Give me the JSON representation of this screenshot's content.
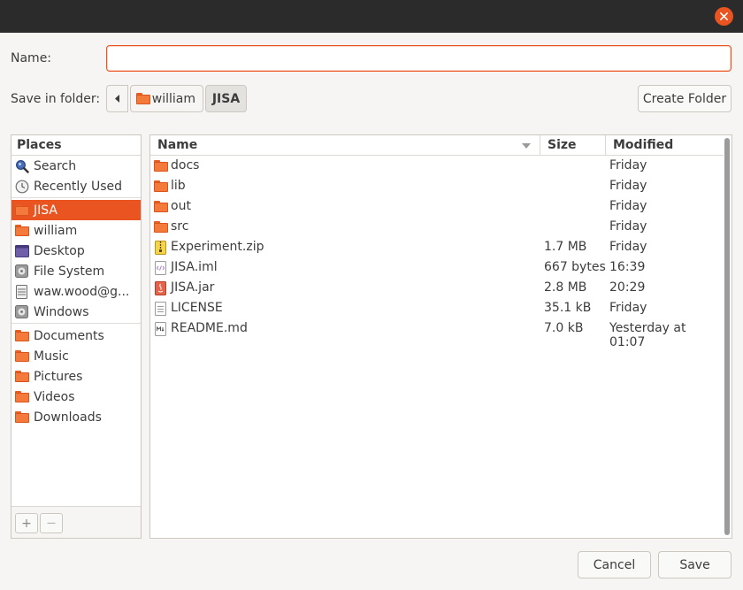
{
  "dialog": {
    "name_label": "Name:",
    "name_value": "",
    "save_in_label": "Save in folder:",
    "breadcrumbs": [
      "william",
      "JISA"
    ],
    "create_folder": "Create Folder",
    "cancel": "Cancel",
    "save": "Save"
  },
  "places": {
    "header": "Places",
    "items": [
      {
        "label": "Search",
        "icon": "search-icon"
      },
      {
        "label": "Recently Used",
        "icon": "recent-icon"
      },
      {
        "label": "JISA",
        "icon": "folder-icon",
        "selected": true
      },
      {
        "label": "william",
        "icon": "folder-icon"
      },
      {
        "label": "Desktop",
        "icon": "desktop-icon"
      },
      {
        "label": "File System",
        "icon": "drive-icon"
      },
      {
        "label": "waw.wood@g...",
        "icon": "network-drive-icon"
      },
      {
        "label": "Windows",
        "icon": "drive-icon"
      },
      {
        "label": "Documents",
        "icon": "folder-icon"
      },
      {
        "label": "Music",
        "icon": "folder-icon"
      },
      {
        "label": "Pictures",
        "icon": "folder-icon"
      },
      {
        "label": "Videos",
        "icon": "folder-icon"
      },
      {
        "label": "Downloads",
        "icon": "folder-icon"
      }
    ],
    "add": "+",
    "remove": "—"
  },
  "files": {
    "columns": {
      "name": "Name",
      "size": "Size",
      "modified": "Modified"
    },
    "rows": [
      {
        "name": "docs",
        "size": "",
        "modified": "Friday",
        "icon": "folder-icon"
      },
      {
        "name": "lib",
        "size": "",
        "modified": "Friday",
        "icon": "folder-icon"
      },
      {
        "name": "out",
        "size": "",
        "modified": "Friday",
        "icon": "folder-icon"
      },
      {
        "name": "src",
        "size": "",
        "modified": "Friday",
        "icon": "folder-icon"
      },
      {
        "name": "Experiment.zip",
        "size": "1.7 MB",
        "modified": "Friday",
        "icon": "zip-icon"
      },
      {
        "name": "JISA.iml",
        "size": "667 bytes",
        "modified": "16:39",
        "icon": "xml-icon"
      },
      {
        "name": "JISA.jar",
        "size": "2.8 MB",
        "modified": "20:29",
        "icon": "java-icon"
      },
      {
        "name": "LICENSE",
        "size": "35.1 kB",
        "modified": "Friday",
        "icon": "text-icon"
      },
      {
        "name": "README.md",
        "size": "7.0 kB",
        "modified": "Yesterday at 01:07",
        "icon": "markdown-icon"
      }
    ]
  },
  "colors": {
    "accent": "#e95420",
    "titlebar": "#2b2b2b",
    "folder": "#f37a3a"
  }
}
